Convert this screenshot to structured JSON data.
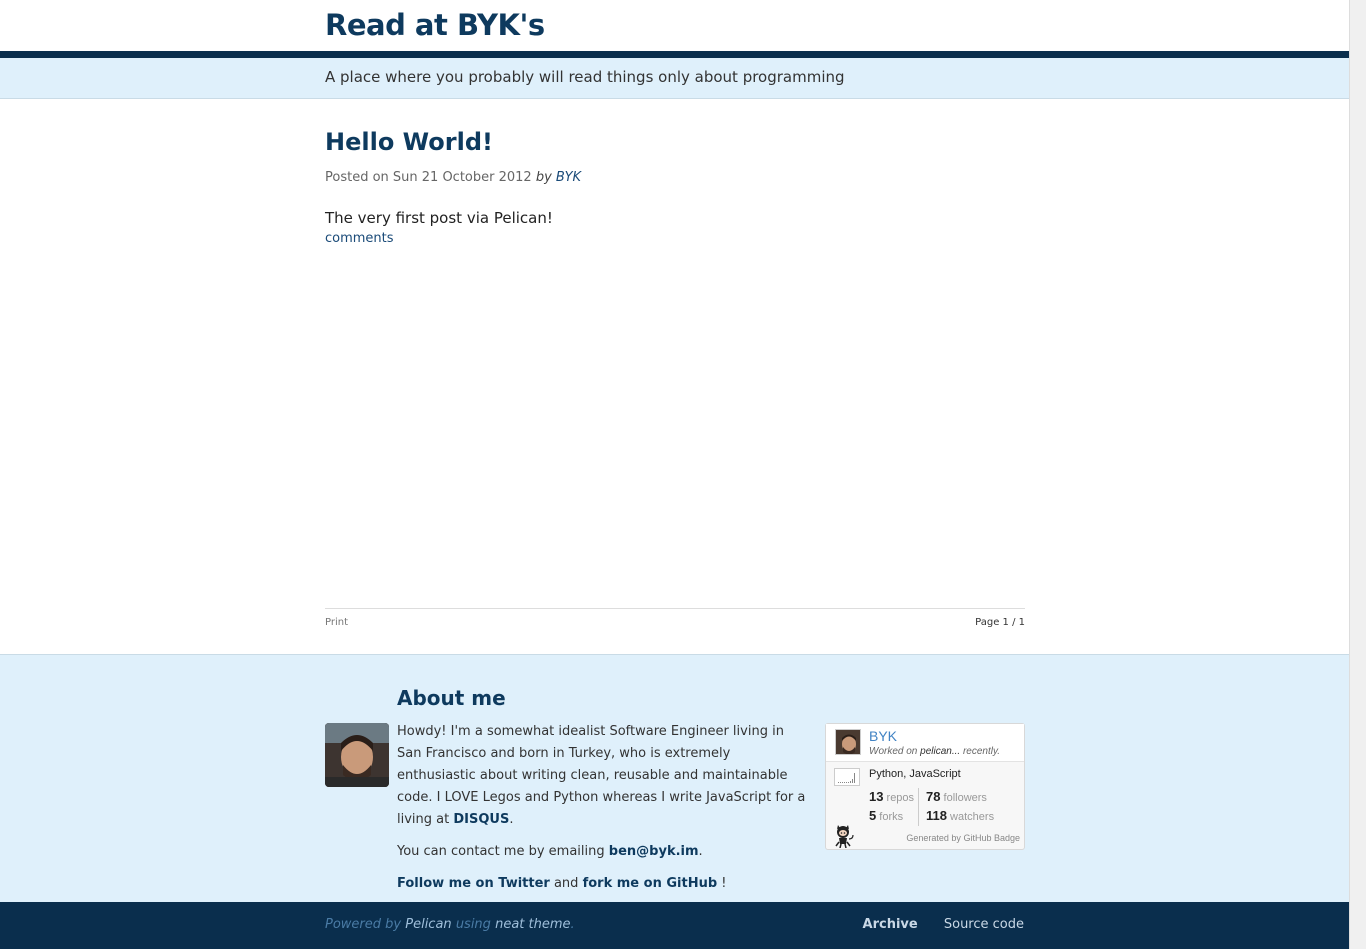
{
  "header": {
    "site_title": "Read at BYK's",
    "tagline": "A place where you probably will read things only about programming"
  },
  "post": {
    "title": "Hello World!",
    "meta_prefix": "Posted on Sun 21 October 2012",
    "by": "by",
    "author": "BYK",
    "body": "The very first post via Pelican!",
    "comments_label": "comments"
  },
  "pager": {
    "print_label": "Print",
    "page_info": "Page 1 / 1"
  },
  "about": {
    "title": "About me",
    "intro": "Howdy! I'm a somewhat idealist Software Engineer living in San Francisco and born in Turkey, who is extremely enthusiastic about writing clean, reusable and maintainable code. I LOVE Legos and Python whereas I write JavaScript for a living at",
    "disqus_link": "DISQUS",
    "intro_end": ".",
    "contact_prefix": "You can contact me by emailing",
    "email": "ben@byk.im",
    "contact_end": ".",
    "twitter_link": "Follow me on Twitter",
    "and": "and",
    "github_link": "fork me on GitHub",
    "follow_end": "!"
  },
  "github_badge": {
    "name": "BYK",
    "activity_prefix": "Worked on",
    "activity_repo": "pelican...",
    "activity_suffix": "recently.",
    "languages": "Python, JavaScript",
    "repos_count": "13",
    "repos_label": "repos",
    "forks_count": "5",
    "forks_label": "forks",
    "followers_count": "78",
    "followers_label": "followers",
    "watchers_count": "118",
    "watchers_label": "watchers",
    "generated_by": "Generated by",
    "generator_name": "GitHub Badge"
  },
  "footer": {
    "powered_by": "Powered by",
    "pelican": "Pelican",
    "using": "using",
    "theme": "neat theme",
    "period": ".",
    "archive_label": "Archive",
    "source_label": "Source code"
  },
  "colors": {
    "brand_dark": "#0a2e4d",
    "title_blue": "#0e3a5e",
    "band_light": "#dff0fb",
    "link_blue": "#4183c4"
  }
}
